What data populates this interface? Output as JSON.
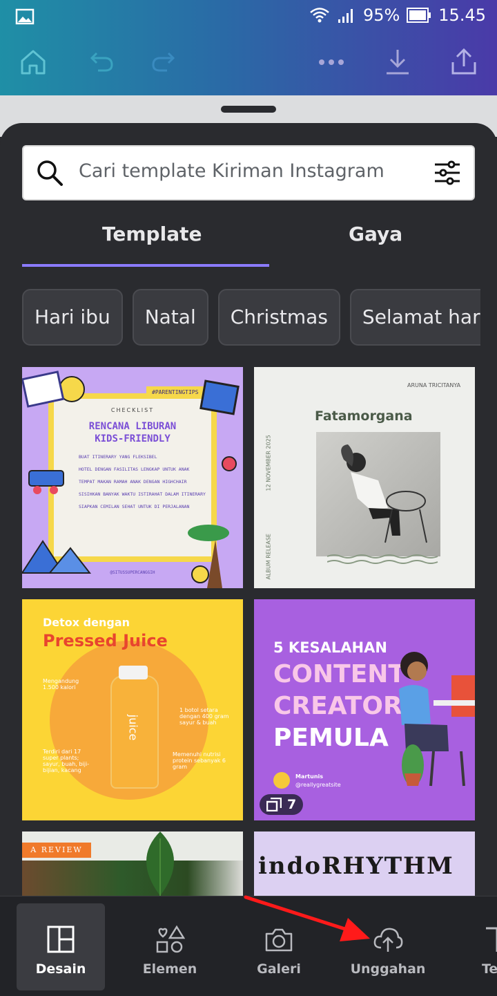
{
  "status": {
    "battery": "95%",
    "time": "15.45"
  },
  "search": {
    "placeholder": "Cari template Kiriman Instagram"
  },
  "tabs": [
    {
      "label": "Template",
      "active": true
    },
    {
      "label": "Gaya",
      "active": false
    }
  ],
  "chips": [
    "Hari ibu",
    "Natal",
    "Christmas",
    "Selamat hari ibu"
  ],
  "cards": {
    "c1": {
      "tag": "#PARENTINGTIPS",
      "kicker": "CHECKLIST",
      "title1": "RENCANA LIBURAN",
      "title2": "KIDS-FRIENDLY",
      "items": [
        "BUAT ITINERARY YANG FLEKSIBEL",
        "HOTEL DENGAN FASILITAS LENGKAP UNTUK ANAK",
        "TEMPAT MAKAN RAMAH ANAK DENGAN HIGHCHAIR",
        "SISIHKAN BANYAK WAKTU ISTIRAHAT DALAM ITINERARY",
        "SIAPKAN CEMILAN SEHAT UNTUK DI PERJALANAN"
      ],
      "handle": "@SITUSSUPERCANGGIH"
    },
    "c2": {
      "brand": "ARUNA TRICITANYA",
      "title": "Fatamorgana",
      "date": "12 NOVEMBER 2025",
      "side": "ALBUM RELEASE"
    },
    "c3": {
      "t1": "Detox dengan",
      "t2": "Pressed Juice",
      "a": "Mengandung 1.500 kalori",
      "b": "1 botol setara dengan 400 gram sayur & buah",
      "c": "Terdiri dari 17 super plants; sayur, buah, biji-bijian, kacang",
      "d": "Memenuhi nutrisi protein sebanyak 6 gram",
      "bottle": "juice"
    },
    "c4": {
      "l1": "5 KESALAHAN",
      "l2": "CONTENT",
      "l3": "CREATOR",
      "l4": "PEMULA",
      "author": "Martunis",
      "handle": "@reallygreatsite",
      "count": "7"
    },
    "c5": {
      "tag": "A REVIEW"
    },
    "c6": {
      "title": "indoRHYTHM"
    }
  },
  "nav": [
    {
      "label": "Desain",
      "icon": "layout-icon",
      "active": true
    },
    {
      "label": "Elemen",
      "icon": "shapes-icon",
      "active": false
    },
    {
      "label": "Galeri",
      "icon": "camera-icon",
      "active": false
    },
    {
      "label": "Unggahan",
      "icon": "cloud-upload-icon",
      "active": false
    },
    {
      "label": "Teks",
      "icon": "text-icon",
      "active": false
    }
  ],
  "colors": {
    "accent": "#8b7bff",
    "annotation_arrow": "#ff1a1a",
    "sheet_bg": "#2a2b2f"
  }
}
